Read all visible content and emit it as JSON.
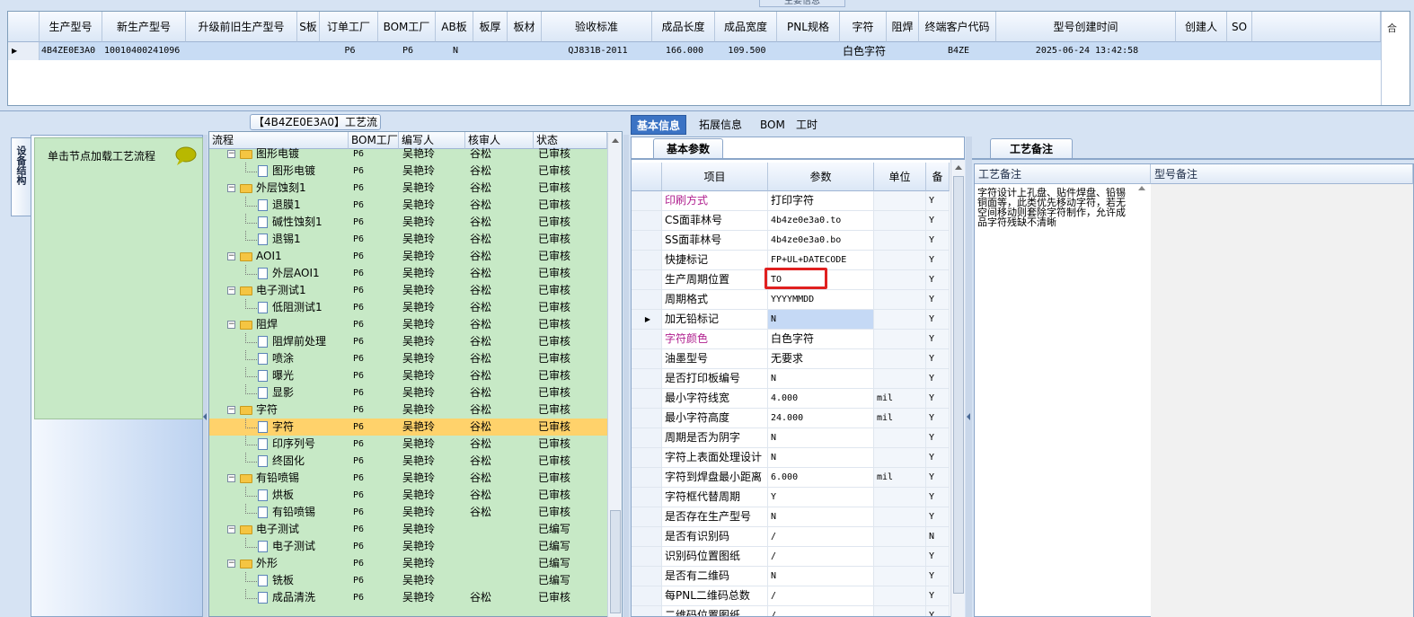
{
  "top_grid": {
    "legend": "主要信息",
    "columns": [
      "生产型号",
      "新生产型号",
      "升级前旧生产型号",
      "S板",
      "订单工厂",
      "BOM工厂",
      "AB板",
      "板厚",
      "板材",
      "验收标准",
      "成品长度",
      "成品宽度",
      "PNL规格",
      "字符",
      "阻焊",
      "终端客户代码",
      "型号创建时间",
      "创建人",
      "SO"
    ],
    "row": [
      "4B4ZE0E3A0",
      "10010400241096",
      "",
      "",
      "P6",
      "P6",
      "N",
      "",
      "",
      "QJ831B-2011",
      "166.000",
      "109.500",
      "",
      "白色字符",
      "",
      "B4ZE",
      "2025-06-24 13:42:58",
      "",
      ""
    ],
    "extra_header": "合"
  },
  "left_panel": {
    "vertical_tab": "设备结构",
    "load_hint": "单击节点加载工艺流程"
  },
  "flow_panel": {
    "title": "【4B4ZE0E3A0】工艺流程",
    "columns": [
      "流程",
      "BOM工厂",
      "编写人",
      "核审人",
      "状态"
    ],
    "rows": [
      {
        "level": 1,
        "type": "folder",
        "name": "图形电镀",
        "bom": "P6",
        "writer": "吴艳玲",
        "reviewer": "谷松",
        "status": "已审核"
      },
      {
        "level": 2,
        "type": "doc",
        "name": "图形电镀",
        "bom": "P6",
        "writer": "吴艳玲",
        "reviewer": "谷松",
        "status": "已审核"
      },
      {
        "level": 1,
        "type": "folder",
        "name": "外层蚀刻1",
        "bom": "P6",
        "writer": "吴艳玲",
        "reviewer": "谷松",
        "status": "已审核"
      },
      {
        "level": 2,
        "type": "doc",
        "name": "退膜1",
        "bom": "P6",
        "writer": "吴艳玲",
        "reviewer": "谷松",
        "status": "已审核"
      },
      {
        "level": 2,
        "type": "doc",
        "name": "碱性蚀刻1",
        "bom": "P6",
        "writer": "吴艳玲",
        "reviewer": "谷松",
        "status": "已审核"
      },
      {
        "level": 2,
        "type": "doc",
        "name": "退锡1",
        "bom": "P6",
        "writer": "吴艳玲",
        "reviewer": "谷松",
        "status": "已审核"
      },
      {
        "level": 1,
        "type": "folder",
        "name": "AOI1",
        "bom": "P6",
        "writer": "吴艳玲",
        "reviewer": "谷松",
        "status": "已审核"
      },
      {
        "level": 2,
        "type": "doc",
        "name": "外层AOI1",
        "bom": "P6",
        "writer": "吴艳玲",
        "reviewer": "谷松",
        "status": "已审核"
      },
      {
        "level": 1,
        "type": "folder",
        "name": "电子测试1",
        "bom": "P6",
        "writer": "吴艳玲",
        "reviewer": "谷松",
        "status": "已审核"
      },
      {
        "level": 2,
        "type": "doc",
        "name": "低阻测试1",
        "bom": "P6",
        "writer": "吴艳玲",
        "reviewer": "谷松",
        "status": "已审核"
      },
      {
        "level": 1,
        "type": "folder",
        "name": "阻焊",
        "bom": "P6",
        "writer": "吴艳玲",
        "reviewer": "谷松",
        "status": "已审核"
      },
      {
        "level": 2,
        "type": "doc",
        "name": "阻焊前处理",
        "bom": "P6",
        "writer": "吴艳玲",
        "reviewer": "谷松",
        "status": "已审核"
      },
      {
        "level": 2,
        "type": "doc",
        "name": "喷涂",
        "bom": "P6",
        "writer": "吴艳玲",
        "reviewer": "谷松",
        "status": "已审核"
      },
      {
        "level": 2,
        "type": "doc",
        "name": "曝光",
        "bom": "P6",
        "writer": "吴艳玲",
        "reviewer": "谷松",
        "status": "已审核"
      },
      {
        "level": 2,
        "type": "doc",
        "name": "显影",
        "bom": "P6",
        "writer": "吴艳玲",
        "reviewer": "谷松",
        "status": "已审核"
      },
      {
        "level": 1,
        "type": "folder",
        "name": "字符",
        "bom": "P6",
        "writer": "吴艳玲",
        "reviewer": "谷松",
        "status": "已审核"
      },
      {
        "level": 2,
        "type": "doc",
        "name": "字符",
        "bom": "P6",
        "writer": "吴艳玲",
        "reviewer": "谷松",
        "status": "已审核",
        "selected": true
      },
      {
        "level": 2,
        "type": "doc",
        "name": "印序列号",
        "bom": "P6",
        "writer": "吴艳玲",
        "reviewer": "谷松",
        "status": "已审核"
      },
      {
        "level": 2,
        "type": "doc",
        "name": "终固化",
        "bom": "P6",
        "writer": "吴艳玲",
        "reviewer": "谷松",
        "status": "已审核"
      },
      {
        "level": 1,
        "type": "folder",
        "name": "有铅喷锡",
        "bom": "P6",
        "writer": "吴艳玲",
        "reviewer": "谷松",
        "status": "已审核"
      },
      {
        "level": 2,
        "type": "doc",
        "name": "烘板",
        "bom": "P6",
        "writer": "吴艳玲",
        "reviewer": "谷松",
        "status": "已审核"
      },
      {
        "level": 2,
        "type": "doc",
        "name": "有铅喷锡",
        "bom": "P6",
        "writer": "吴艳玲",
        "reviewer": "谷松",
        "status": "已审核"
      },
      {
        "level": 1,
        "type": "folder",
        "name": "电子测试",
        "bom": "P6",
        "writer": "吴艳玲",
        "reviewer": "",
        "status": "已编写"
      },
      {
        "level": 2,
        "type": "doc",
        "name": "电子测试",
        "bom": "P6",
        "writer": "吴艳玲",
        "reviewer": "",
        "status": "已编写"
      },
      {
        "level": 1,
        "type": "folder",
        "name": "外形",
        "bom": "P6",
        "writer": "吴艳玲",
        "reviewer": "",
        "status": "已编写"
      },
      {
        "level": 2,
        "type": "doc",
        "name": "铣板",
        "bom": "P6",
        "writer": "吴艳玲",
        "reviewer": "",
        "status": "已编写"
      },
      {
        "level": 2,
        "type": "doc",
        "name": "成品清洗",
        "bom": "P6",
        "writer": "吴艳玲",
        "reviewer": "谷松",
        "status": "已审核"
      }
    ]
  },
  "right_tabs": [
    "基本信息",
    "拓展信息",
    "BOM",
    "工时"
  ],
  "param_panel": {
    "subtab": "基本参数",
    "columns": [
      "项目",
      "参数",
      "单位",
      "备"
    ],
    "rows": [
      {
        "item": "印刷方式",
        "value": "打印字符",
        "unit": "",
        "flag": "Y",
        "magenta": true
      },
      {
        "item": "CS面菲林号",
        "value": "4b4ze0e3a0.to",
        "unit": "",
        "flag": "Y"
      },
      {
        "item": "SS面菲林号",
        "value": "4b4ze0e3a0.bo",
        "unit": "",
        "flag": "Y"
      },
      {
        "item": "快捷标记",
        "value": "FP+UL+DATECODE",
        "unit": "",
        "flag": "Y"
      },
      {
        "item": "生产周期位置",
        "value": "TO",
        "unit": "",
        "flag": "Y",
        "highlight": true
      },
      {
        "item": "周期格式",
        "value": "YYYYMMDD",
        "unit": "",
        "flag": "Y"
      },
      {
        "item": "加无铅标记",
        "value": "N",
        "unit": "",
        "flag": "Y",
        "current": true
      },
      {
        "item": "字符颜色",
        "value": "白色字符",
        "unit": "",
        "flag": "Y",
        "magenta": true
      },
      {
        "item": "油墨型号",
        "value": "无要求",
        "unit": "",
        "flag": "Y"
      },
      {
        "item": "是否打印板编号",
        "value": "N",
        "unit": "",
        "flag": "Y"
      },
      {
        "item": "最小字符线宽",
        "value": "4.000",
        "unit": "mil",
        "flag": "Y"
      },
      {
        "item": "最小字符高度",
        "value": "24.000",
        "unit": "mil",
        "flag": "Y"
      },
      {
        "item": "周期是否为阴字",
        "value": "N",
        "unit": "",
        "flag": "Y"
      },
      {
        "item": "字符上表面处理设计",
        "value": "N",
        "unit": "",
        "flag": "Y"
      },
      {
        "item": "字符到焊盘最小距离",
        "value": "6.000",
        "unit": "mil",
        "flag": "Y"
      },
      {
        "item": "字符框代替周期",
        "value": "Y",
        "unit": "",
        "flag": "Y"
      },
      {
        "item": "是否存在生产型号",
        "value": "N",
        "unit": "",
        "flag": "Y"
      },
      {
        "item": "是否有识别码",
        "value": "/",
        "unit": "",
        "flag": "N"
      },
      {
        "item": "识别码位置图纸",
        "value": "/",
        "unit": "",
        "flag": "Y"
      },
      {
        "item": "是否有二维码",
        "value": "N",
        "unit": "",
        "flag": "Y"
      },
      {
        "item": "每PNL二维码总数",
        "value": "/",
        "unit": "",
        "flag": "Y"
      },
      {
        "item": "二维码位置图纸",
        "value": "/",
        "unit": "",
        "flag": "Y"
      }
    ]
  },
  "notes_panel": {
    "tab": "工艺备注",
    "columns": [
      "工艺备注",
      "型号备注"
    ],
    "process_note": "字符设计上孔盘、贴件焊盘、铅锡铜面等，此类优先移动字符，若无空间移动则套除字符制作，允许成品字符残缺不清晰",
    "model_note": ""
  },
  "colors": {
    "selected_row": "#ffd26b",
    "tree_bg": "#c7e9c6",
    "highlight_box": "#e02020",
    "magenta_label": "#b0208f",
    "active_tab": "#3b73c4"
  }
}
